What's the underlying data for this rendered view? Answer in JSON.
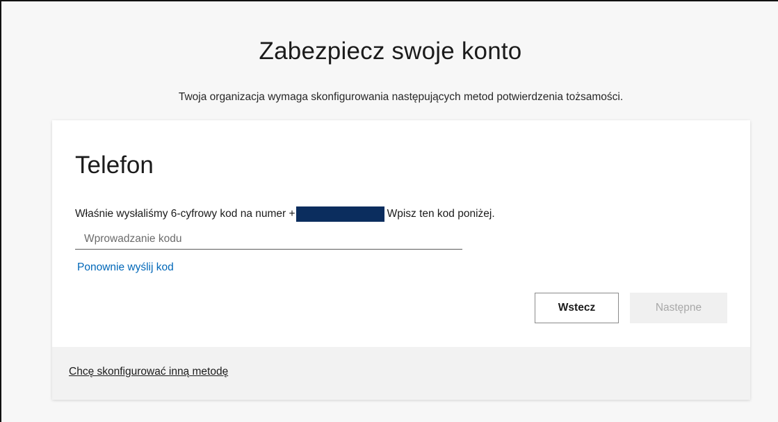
{
  "page": {
    "title": "Zabezpiecz swoje konto",
    "subtitle": "Twoja organizacja wymaga skonfigurowania następujących metod potwierdzenia tożsamości."
  },
  "card": {
    "section_title": "Telefon",
    "instruction_prefix": "Właśnie wysłaliśmy 6-cyfrowy kod na numer +",
    "instruction_suffix": "Wpisz ten kod poniżej.",
    "code_input": {
      "value": "",
      "placeholder": "Wprowadzanie kodu"
    },
    "resend_link": "Ponownie wyślij kod",
    "buttons": {
      "back": "Wstecz",
      "next": "Następne"
    },
    "footer_link": "Chcę skonfigurować inną metodę"
  },
  "colors": {
    "link": "#0067b8",
    "redaction": "#0b2d5e",
    "disabled_button_bg": "#f0f0f0",
    "footer_bg": "#f2f2f2"
  }
}
